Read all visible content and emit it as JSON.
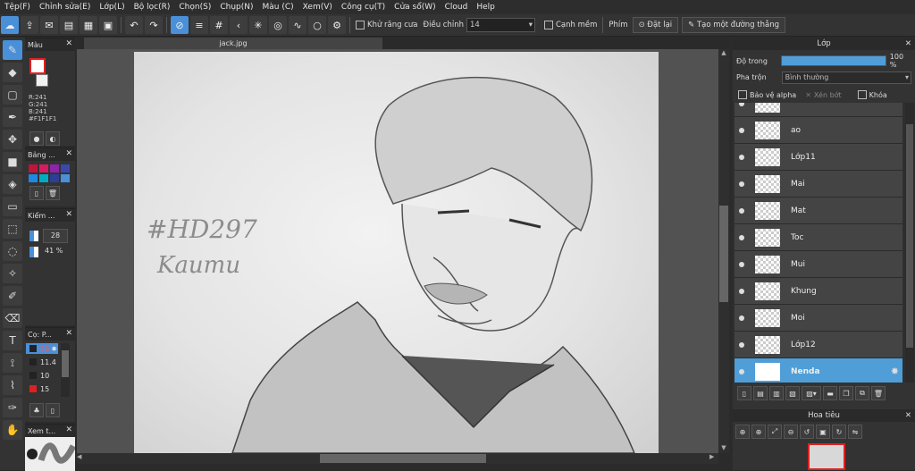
{
  "menu": [
    "Tệp(F)",
    "Chỉnh sửa(E)",
    "Lớp(L)",
    "Bộ lọc(R)",
    "Chọn(S)",
    "Chụp(N)",
    "Màu (C)",
    "Xem(V)",
    "Công cụ(T)",
    "Cửa sổ(W)",
    "Cloud",
    "Help"
  ],
  "toolbar": {
    "antialias_label": "Khử răng cưa",
    "adjust_label": "Điều chỉnh",
    "adjust_value": "14",
    "soft_edge_label": "Cạnh mềm",
    "key_label": "Phím",
    "reset_label": "Đặt lại",
    "straight_line_label": "Tạo một đường thẳng"
  },
  "color_panel": {
    "title": "Màu",
    "r": "R:241",
    "g": "G:241",
    "b": "B:241",
    "hex": "#F1F1F1",
    "fg_color": "#e02020",
    "bg_color": "#f1f1f1"
  },
  "palette_panel": {
    "title": "Bảng ...",
    "swatches": [
      "#c0143c",
      "#d81b60",
      "#8e24aa",
      "#3949ab",
      "#1e88e5",
      "#00acc1",
      "#2c3e95",
      "#4a90d9"
    ]
  },
  "check_panel": {
    "title": "Kiểm ...",
    "value1": "28",
    "value2": "41 %"
  },
  "brush_panel": {
    "title": "Cọ: P...",
    "sizes": [
      "20",
      "11.4",
      "10",
      "15"
    ]
  },
  "preview_panel": {
    "title": "Xem t..."
  },
  "document": {
    "tab_name": "jack.jpg"
  },
  "artwork": {
    "watermark_line1": "#HD297",
    "watermark_line2": "Kaumu"
  },
  "layers_panel": {
    "title": "Lớp",
    "opacity_label": "Độ trong",
    "opacity_value": "100 %",
    "opacity_fraction": 1.0,
    "blend_label": "Pha trộn",
    "blend_value": "Bình thường",
    "protect_alpha_label": "Bảo vệ alpha",
    "clip_label": "Xén bớt",
    "lock_label": "Khóa",
    "layers": [
      "ao",
      "Lớp11",
      "Mai",
      "Mat",
      "Toc",
      "Mui",
      "Khung",
      "Moi",
      "Lớp12",
      "Nenda"
    ],
    "selected_layer": "Nenda"
  },
  "navigator_panel": {
    "title": "Hoa tiêu"
  }
}
